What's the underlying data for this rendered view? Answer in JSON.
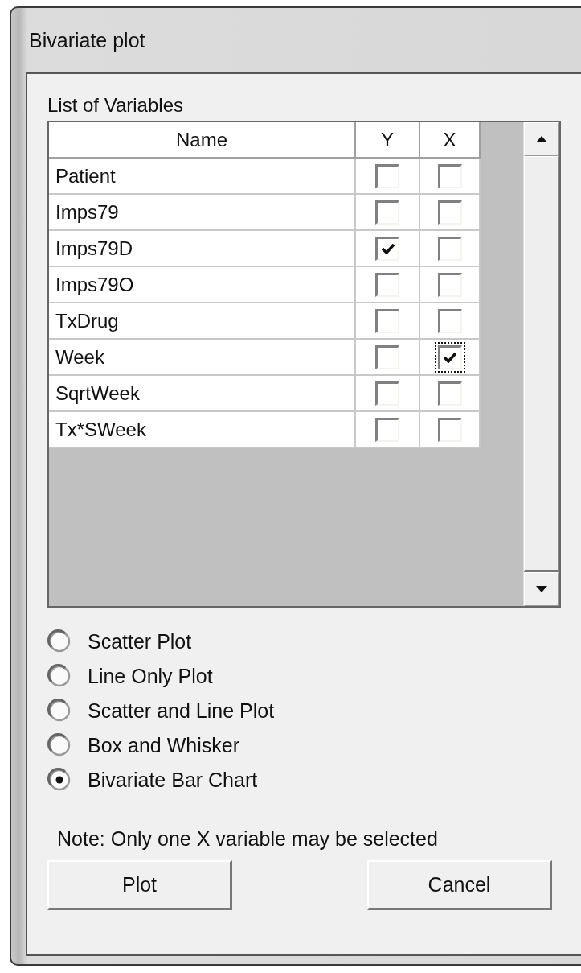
{
  "window": {
    "title": "Bivariate plot"
  },
  "variables": {
    "label": "List of Variables",
    "columns": [
      "Name",
      "Y",
      "X"
    ],
    "rows": [
      {
        "name": "Patient",
        "y": {
          "checked": false,
          "focused": false
        },
        "x": {
          "checked": false,
          "focused": false
        }
      },
      {
        "name": "Imps79",
        "y": {
          "checked": false,
          "focused": false
        },
        "x": {
          "checked": false,
          "focused": false
        }
      },
      {
        "name": "Imps79D",
        "y": {
          "checked": true,
          "focused": false
        },
        "x": {
          "checked": false,
          "focused": false
        }
      },
      {
        "name": "Imps79O",
        "y": {
          "checked": false,
          "focused": false
        },
        "x": {
          "checked": false,
          "focused": false
        }
      },
      {
        "name": "TxDrug",
        "y": {
          "checked": false,
          "focused": false
        },
        "x": {
          "checked": false,
          "focused": false
        }
      },
      {
        "name": "Week",
        "y": {
          "checked": false,
          "focused": false
        },
        "x": {
          "checked": true,
          "focused": true
        }
      },
      {
        "name": "SqrtWeek",
        "y": {
          "checked": false,
          "focused": false
        },
        "x": {
          "checked": false,
          "focused": false
        }
      },
      {
        "name": "Tx*SWeek",
        "y": {
          "checked": false,
          "focused": false
        },
        "x": {
          "checked": false,
          "focused": false
        }
      }
    ]
  },
  "plot_types": [
    {
      "label": "Scatter Plot",
      "selected": false
    },
    {
      "label": "Line Only Plot",
      "selected": false
    },
    {
      "label": "Scatter and Line Plot",
      "selected": false
    },
    {
      "label": "Box and Whisker",
      "selected": false
    },
    {
      "label": "Bivariate Bar Chart",
      "selected": true
    }
  ],
  "note": "Note: Only one X variable may be selected",
  "buttons": [
    "Plot",
    "Cancel"
  ]
}
